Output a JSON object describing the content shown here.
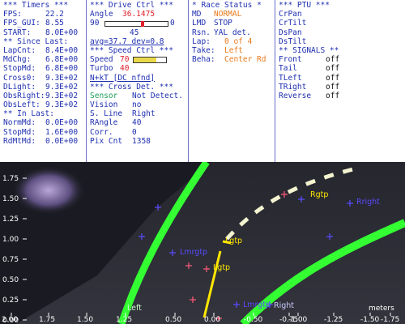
{
  "timers": {
    "header": "*** Timers ***",
    "rows": [
      {
        "label": "FPS:",
        "value": "22.2"
      },
      {
        "label": "FPS_GUI:",
        "value": "8.55"
      },
      {
        "label": "START:",
        "value": "8.0E+00"
      }
    ],
    "since_header": "** Since Last:",
    "since_rows": [
      {
        "label": "LapCnt:",
        "value": "8.4E+00"
      },
      {
        "label": "MdChg:",
        "value": "6.8E+00"
      },
      {
        "label": "StopMd:",
        "value": "6.8E+00"
      },
      {
        "label": "Cross0:",
        "value": "9.3E+02"
      },
      {
        "label": "DLight:",
        "value": "9.3E+02"
      },
      {
        "label": "ObsRight:",
        "value": "9.3E+02"
      },
      {
        "label": "ObsLeft:",
        "value": "9.3E+02"
      }
    ],
    "inlast_header": "** In Last:",
    "inlast_rows": [
      {
        "label": "NormMd:",
        "value": "0.0E+00"
      },
      {
        "label": "StopMd:",
        "value": "1.6E+00"
      },
      {
        "label": "RdMtMd:",
        "value": "0.0E+00"
      }
    ]
  },
  "drive": {
    "header": "***  Drive Ctrl  ***",
    "angle_label": "Angle",
    "angle_value": "36.1475",
    "slider_min": "90",
    "slider_max": "0",
    "slider_fraction": 0.6,
    "slider_value": "45",
    "avg_text": "avg=37.7  dev=0.8",
    "speed_header": "***  Speed Ctrl  ***",
    "speed_label": "Speed",
    "speed_value": "70",
    "speed_fill": 0.7,
    "turbo_label": "Turbo",
    "turbo_value": "40",
    "mode_text": "N+kT [DC nfnd]",
    "cross_header": "*** Cross Det. ***",
    "cross_rows": [
      {
        "label": "Sensor",
        "value": "Not Detect."
      },
      {
        "label": "Vision",
        "value": "no"
      },
      {
        "label": "S. Line",
        "value": "Right"
      },
      {
        "label": "RAngle",
        "value": "40"
      },
      {
        "label": "Corr.",
        "value": "0"
      },
      {
        "label": "Pix Cnt",
        "value": "1358"
      }
    ]
  },
  "race": {
    "header": "* Race Status *",
    "rows": [
      {
        "label": "MD",
        "value": "NORMAL",
        "color": "#e87a1c"
      },
      {
        "label": "LMD",
        "value": "STOP",
        "color": "#1f2fb0"
      },
      {
        "label": "Rsn.",
        "value": "YAL det.",
        "color": "#1f2fb0"
      },
      {
        "label": "Lap:",
        "value": "0 of 4",
        "color": "#e87a1c"
      },
      {
        "label": "Take:",
        "value": "Left",
        "color": "#e87a1c"
      },
      {
        "label": "Beha:",
        "value": "Center Rd",
        "color": "#e87a1c"
      }
    ]
  },
  "ptu": {
    "header": "*** PTU ***",
    "items": [
      "CrPan",
      "CrTilt",
      "DsPan",
      "DsTilt"
    ],
    "signals_header": "** SIGNALS **",
    "signals": [
      {
        "label": "Front",
        "value": "off"
      },
      {
        "label": "Tail",
        "value": "off"
      },
      {
        "label": "TLeft",
        "value": "off"
      },
      {
        "label": "TRight",
        "value": "off"
      },
      {
        "label": "Reverse",
        "value": "off"
      }
    ]
  },
  "camera": {
    "y_ticks": [
      "1.75",
      "1.50",
      "1.25",
      "1.00",
      "0.75",
      "0.50",
      "0.25",
      "0.00"
    ],
    "x_ticks": [
      "2.00",
      "1.75",
      "1.50",
      "1.25",
      "1.00",
      "0.50",
      "0.00",
      "-0.25",
      "-0.50",
      "-0.75",
      "-1.00",
      "-1.25",
      "-1.50",
      "-1.75"
    ],
    "unit": "meters",
    "annotations": [
      "Lgtp",
      "Rrgtp",
      "Lgtp",
      "Rright",
      "Lmrgtp",
      "Lgtp",
      "Lmrgtp",
      "Right",
      "Left"
    ]
  }
}
